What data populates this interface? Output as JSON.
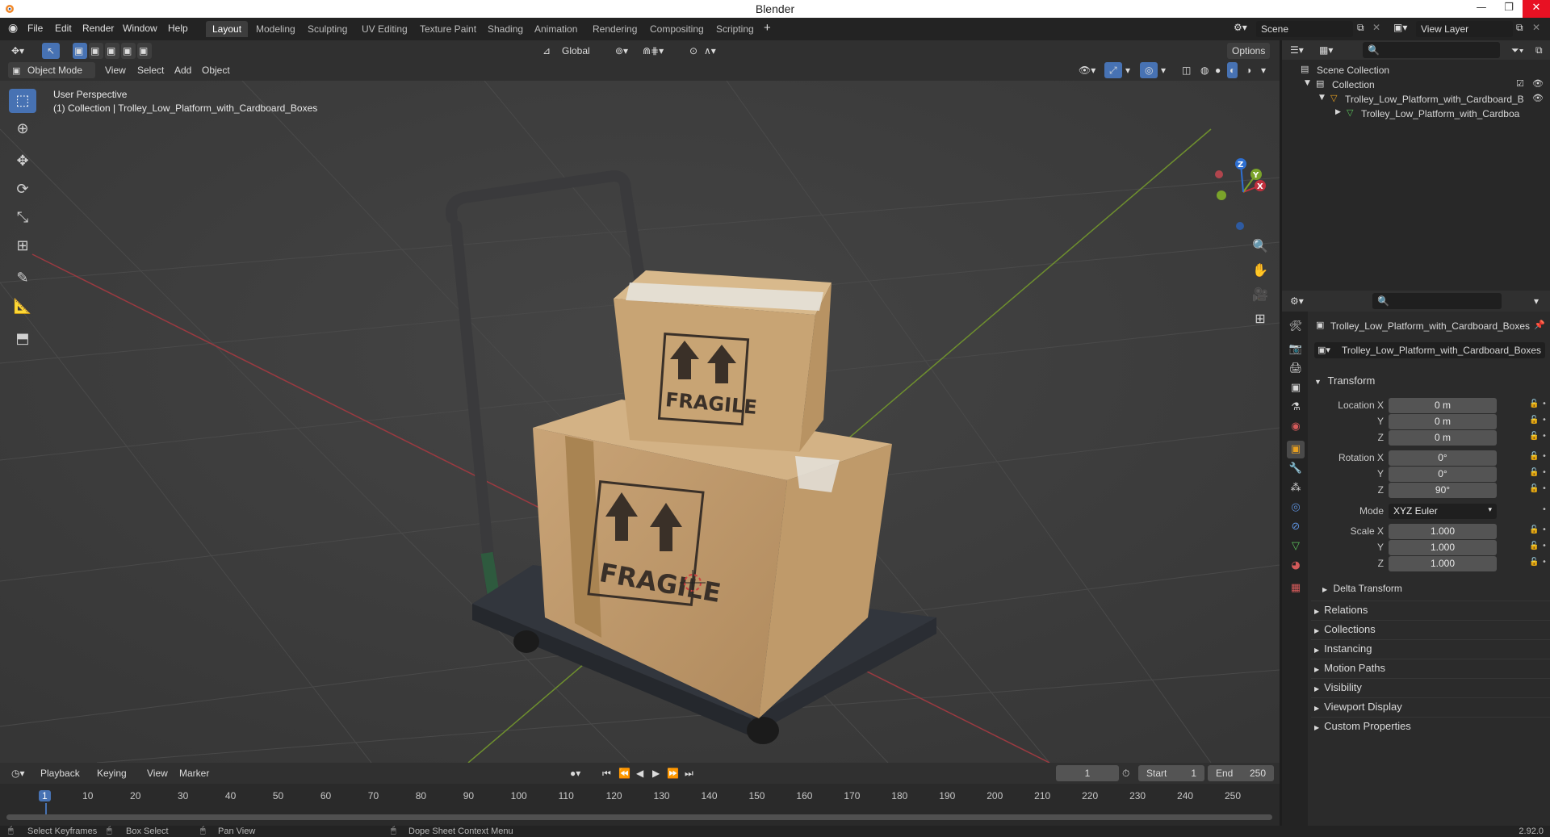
{
  "window": {
    "title": "Blender",
    "min_icon": "minimize-icon",
    "max_icon": "restore-icon",
    "close_icon": "close-icon"
  },
  "menus": [
    "File",
    "Edit",
    "Render",
    "Window",
    "Help"
  ],
  "workspaces": [
    "Layout",
    "Modeling",
    "Sculpting",
    "UV Editing",
    "Texture Paint",
    "Shading",
    "Animation",
    "Rendering",
    "Compositing",
    "Scripting"
  ],
  "scene": {
    "name": "Scene",
    "view_layer": "View Layer"
  },
  "header": {
    "mode": "Object Mode",
    "menus": [
      "View",
      "Select",
      "Add",
      "Object"
    ],
    "orientation": "Global",
    "options": "Options"
  },
  "viewport": {
    "perspective": "User Perspective",
    "collection_info": "(1) Collection | Trolley_Low_Platform_with_Cardboard_Boxes",
    "box_label": "FRAGILE",
    "gizmo": {
      "x": "X",
      "y": "Y",
      "z": "Z"
    }
  },
  "outliner": {
    "scene_collection": "Scene Collection",
    "collection": "Collection",
    "object": "Trolley_Low_Platform_with_Cardboard_B",
    "mesh": "Trolley_Low_Platform_with_Cardboa"
  },
  "properties": {
    "object_name": "Trolley_Low_Platform_with_Cardboard_Boxes",
    "datablock": "Trolley_Low_Platform_with_Cardboard_Boxes",
    "transform_title": "Transform",
    "location": {
      "label_x": "Location X",
      "label_y": "Y",
      "label_z": "Z",
      "x": "0 m",
      "y": "0 m",
      "z": "0 m"
    },
    "rotation": {
      "label_x": "Rotation X",
      "label_y": "Y",
      "label_z": "Z",
      "x": "0°",
      "y": "0°",
      "z": "90°"
    },
    "mode_label": "Mode",
    "mode_value": "XYZ Euler",
    "scale": {
      "label_x": "Scale X",
      "label_y": "Y",
      "label_z": "Z",
      "x": "1.000",
      "y": "1.000",
      "z": "1.000"
    },
    "delta_transform": "Delta Transform",
    "sections": [
      "Relations",
      "Collections",
      "Instancing",
      "Motion Paths",
      "Visibility",
      "Viewport Display",
      "Custom Properties"
    ]
  },
  "timeline": {
    "menus": [
      "Playback",
      "Keying",
      "View",
      "Marker"
    ],
    "current_frame": "1",
    "start_label": "Start",
    "start": "1",
    "end_label": "End",
    "end": "250",
    "ticks": [
      "1",
      "10",
      "20",
      "30",
      "40",
      "50",
      "60",
      "70",
      "80",
      "90",
      "100",
      "110",
      "120",
      "130",
      "140",
      "150",
      "160",
      "170",
      "180",
      "190",
      "200",
      "210",
      "220",
      "230",
      "240",
      "250"
    ],
    "playhead_frame": 1,
    "frame_range": [
      1,
      250
    ]
  },
  "statusbar": {
    "items": [
      "Select Keyframes",
      "Box Select",
      "Pan View",
      "Dope Sheet Context Menu"
    ],
    "version": "2.92.0"
  },
  "colors": {
    "accent": "#4772b3",
    "active_object": "#e8a020",
    "x_axis": "#c0303d",
    "y_axis": "#7aa32a",
    "z_axis": "#2e6fd1"
  }
}
